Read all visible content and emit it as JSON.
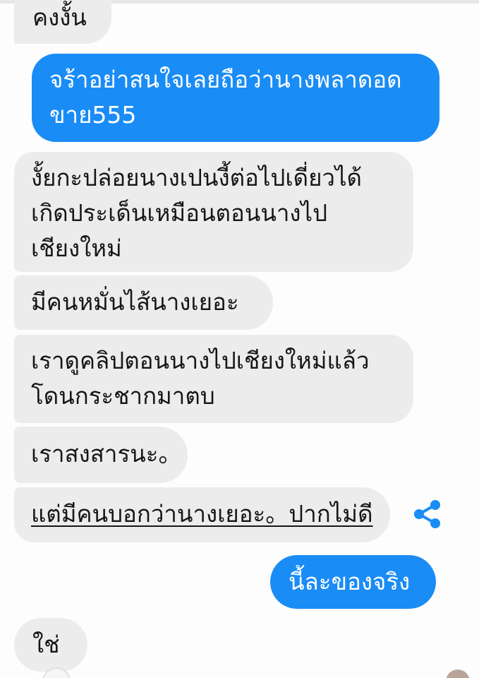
{
  "chat": {
    "colors": {
      "incoming_bubble": "#ececec",
      "outgoing_bubble": "#1a8cf5",
      "share_icon": "#1a8cf5"
    },
    "messages": [
      {
        "side": "incoming",
        "lines": [
          "คงงั้น"
        ]
      },
      {
        "side": "outgoing",
        "lines": [
          "จร้าอย่าสนใจเลยถือว่านางพลาดอด",
          "ขาย555"
        ]
      },
      {
        "side": "incoming",
        "lines": [
          "งั้ยกะปล่อยนางเปนงี้ต่อไปเดี่ยวได้",
          "เกิดประเด็นเหมือนตอนนางไป",
          "เชียงใหม่"
        ]
      },
      {
        "side": "incoming",
        "lines": [
          "มีคนหมั่นไส้นางเยอะ"
        ]
      },
      {
        "side": "incoming",
        "lines": [
          "เราดูคลิปตอนนางไปเชียงใหม่แล้ว",
          "โดนกระชากมาตบ"
        ]
      },
      {
        "side": "incoming",
        "lines": [
          "เราสงสารนะ。"
        ]
      },
      {
        "side": "incoming",
        "lines": [
          "แต่มีคนบอกว่านางเยอะ。ปากไม่ดี"
        ],
        "share_icon": "share-icon"
      },
      {
        "side": "outgoing",
        "lines": [
          "นี้ละของจริง"
        ]
      },
      {
        "side": "incoming",
        "lines": [
          "ใช่"
        ]
      }
    ]
  }
}
